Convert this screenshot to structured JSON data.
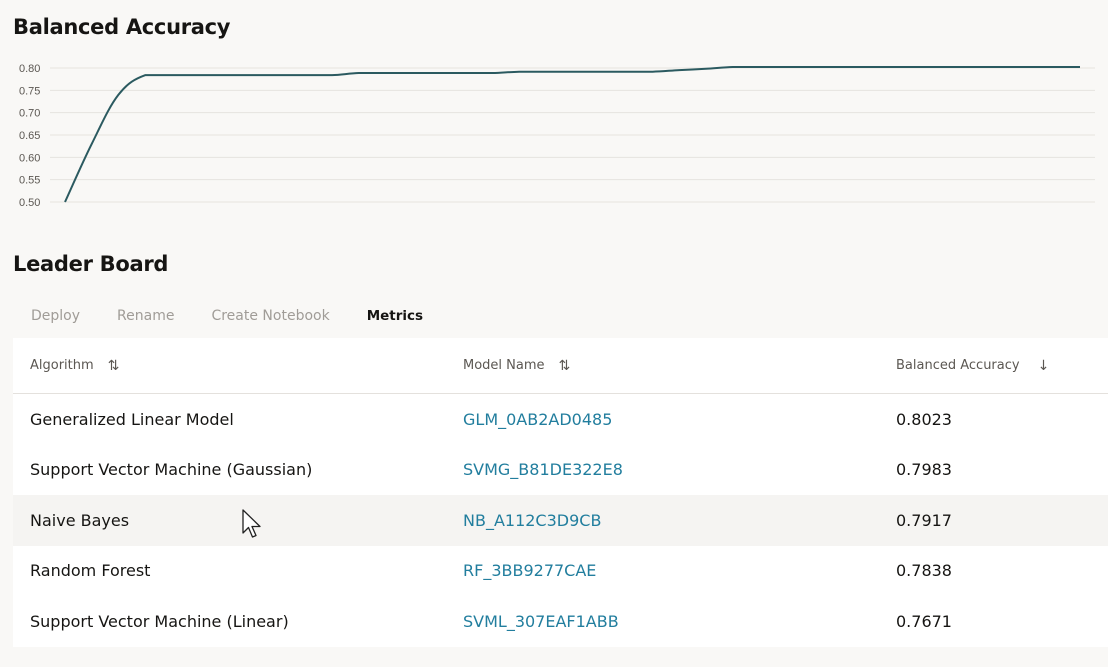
{
  "chart_section": {
    "title": "Balanced Accuracy"
  },
  "chart_data": {
    "type": "line",
    "title": "Balanced Accuracy",
    "xlabel": "",
    "ylabel": "",
    "ylim": [
      0.5,
      0.8
    ],
    "y_ticks": [
      "0.80",
      "0.75",
      "0.70",
      "0.65",
      "0.60",
      "0.55",
      "0.50"
    ],
    "grid": true,
    "series": [
      {
        "values": [
          0.5,
          0.63,
          0.74,
          0.784,
          0.784,
          0.784,
          0.784,
          0.784,
          0.784,
          0.784,
          0.784,
          0.7887,
          0.7887,
          0.7887,
          0.7887,
          0.7887,
          0.7887,
          0.7917,
          0.7917,
          0.7917,
          0.7917,
          0.7917,
          0.7917,
          0.7953,
          0.7983,
          0.8023,
          0.8023,
          0.8023,
          0.8023,
          0.8023,
          0.8023,
          0.8023,
          0.8023,
          0.8023,
          0.8023,
          0.8023,
          0.8023,
          0.8023,
          0.8023
        ],
        "color": "#2b5a60"
      }
    ]
  },
  "leaderboard": {
    "title": "Leader Board",
    "toolbar": {
      "deploy": "Deploy",
      "rename": "Rename",
      "create_notebook": "Create Notebook",
      "metrics": "Metrics"
    },
    "columns": {
      "algorithm": "Algorithm",
      "model_name": "Model Name",
      "balanced_accuracy": "Balanced Accuracy"
    },
    "rows": [
      {
        "algorithm": "Generalized Linear Model",
        "model_name": "GLM_0AB2AD0485",
        "accuracy": "0.8023"
      },
      {
        "algorithm": "Support Vector Machine (Gaussian)",
        "model_name": "SVMG_B81DE322E8",
        "accuracy": "0.7983"
      },
      {
        "algorithm": "Naive Bayes",
        "model_name": "NB_A112C3D9CB",
        "accuracy": "0.7917"
      },
      {
        "algorithm": "Random Forest",
        "model_name": "RF_3BB9277CAE",
        "accuracy": "0.7838"
      },
      {
        "algorithm": "Support Vector Machine (Linear)",
        "model_name": "SVML_307EAF1ABB",
        "accuracy": "0.7671"
      }
    ]
  },
  "icons": {
    "sort_unsorted": "⇅",
    "sort_desc": "↓"
  }
}
